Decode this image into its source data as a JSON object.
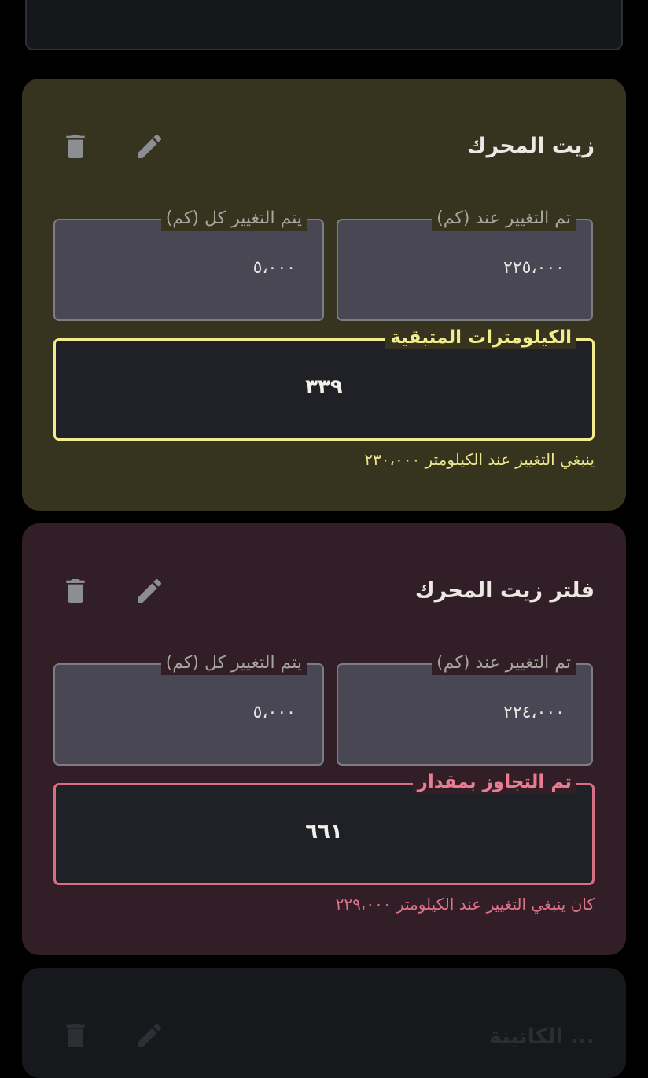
{
  "cards": [
    {
      "title": "زيت المحرك",
      "changed_at_label": "تم التغيير عند (كم)",
      "changed_at_value": "٢٢٥،٠٠٠",
      "interval_label": "يتم التغيير كل (كم)",
      "interval_value": "٥،٠٠٠",
      "status_label": "الكيلومترات المتبقية",
      "status_value": "٣٣٩",
      "helper": "ينبغي التغيير عند الكيلومتر ٢٣٠،٠٠٠",
      "status": "warning",
      "accent": "#f3ec8f"
    },
    {
      "title": "فلتر زيت المحرك",
      "changed_at_label": "تم التغيير عند (كم)",
      "changed_at_value": "٢٢٤،٠٠٠",
      "interval_label": "يتم التغيير كل (كم)",
      "interval_value": "٥،٠٠٠",
      "status_label": "تم التجاوز بمقدار",
      "status_value": "٦٦١",
      "helper": "كان ينبغي التغيير عند الكيلومتر ٢٢٩،٠٠٠",
      "status": "overdue",
      "accent": "#d96e84"
    }
  ],
  "next_card": {
    "title": "... الكاتينة"
  },
  "icons": {
    "delete": "trash-icon",
    "edit": "pencil-icon"
  }
}
